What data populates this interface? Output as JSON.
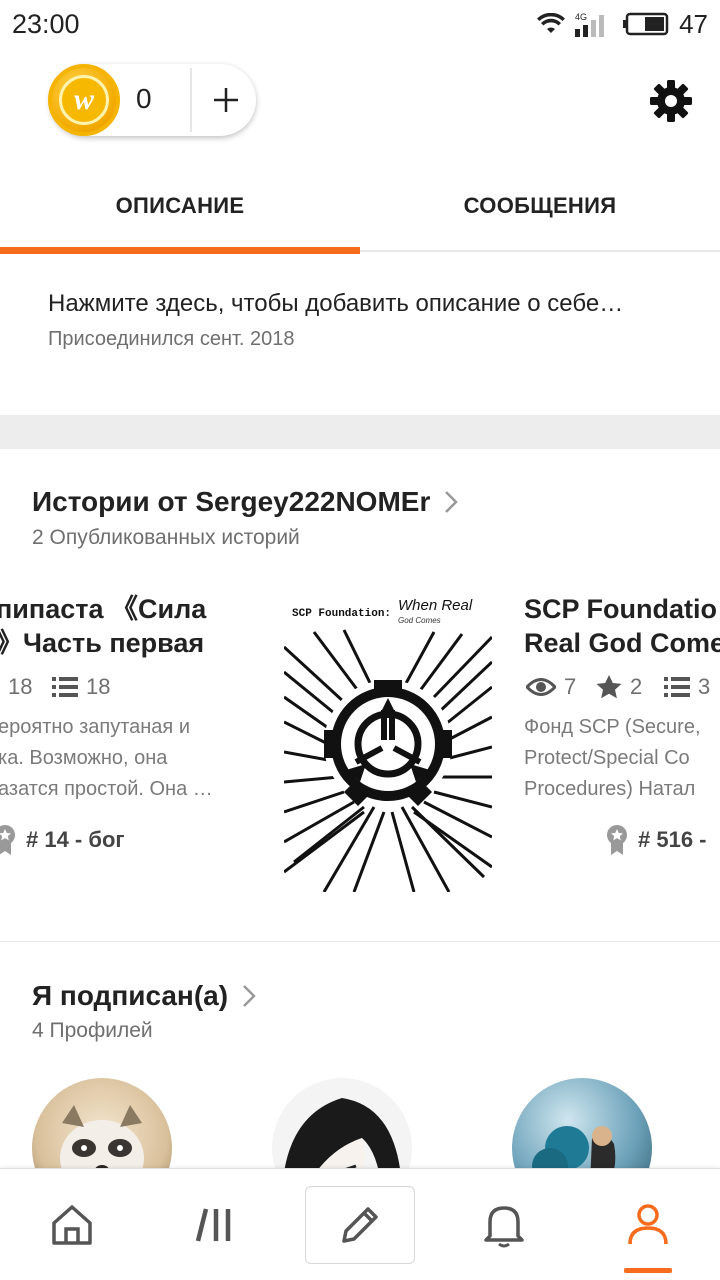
{
  "status_bar": {
    "time": "23:00",
    "network": "4G",
    "battery": "47"
  },
  "coins": {
    "count": "0",
    "coin_symbol": "w"
  },
  "tabs": [
    {
      "label": "ОПИСАНИЕ",
      "active": true
    },
    {
      "label": "СООБЩЕНИЯ",
      "active": false
    }
  ],
  "about": {
    "text": "Нажмите здесь, чтобы добавить описание о себе…",
    "joined": "Присоединился сент. 2018"
  },
  "stories": {
    "title": "Истории от Sergey222NOMEr",
    "subtitle": "2 Опубликованных историй",
    "items": [
      {
        "title_line1": "пипаста 《Сила",
        "title_line2": "》Часть первая",
        "reads": "18",
        "parts": "18",
        "desc_line1": "ероятно запутаная и",
        "desc_line2": "ка. Возможно, она",
        "desc_line3": "азатся простой. Она …",
        "rank": "# 14 - бог"
      },
      {
        "cover_left": "SCP Foundation:",
        "cover_right": "When Real",
        "cover_sub": "God Comes"
      },
      {
        "title_line1": "SCP Foundatio",
        "title_line2": "Real God Come",
        "reads": "7",
        "votes": "2",
        "parts": "3",
        "desc_line1": "Фонд SCP (Secure,",
        "desc_line2": "Protect/Special Co",
        "desc_line3": "Procedures) Натал",
        "rank": "# 516 -"
      }
    ]
  },
  "following": {
    "title": "Я подписан(а)",
    "subtitle": "4 Профилей"
  },
  "colors": {
    "accent": "#f76b1c",
    "coin": "#f5b400"
  },
  "bottom_nav": [
    "home-icon",
    "library-icon",
    "write-icon",
    "notifications-icon",
    "profile-icon"
  ]
}
